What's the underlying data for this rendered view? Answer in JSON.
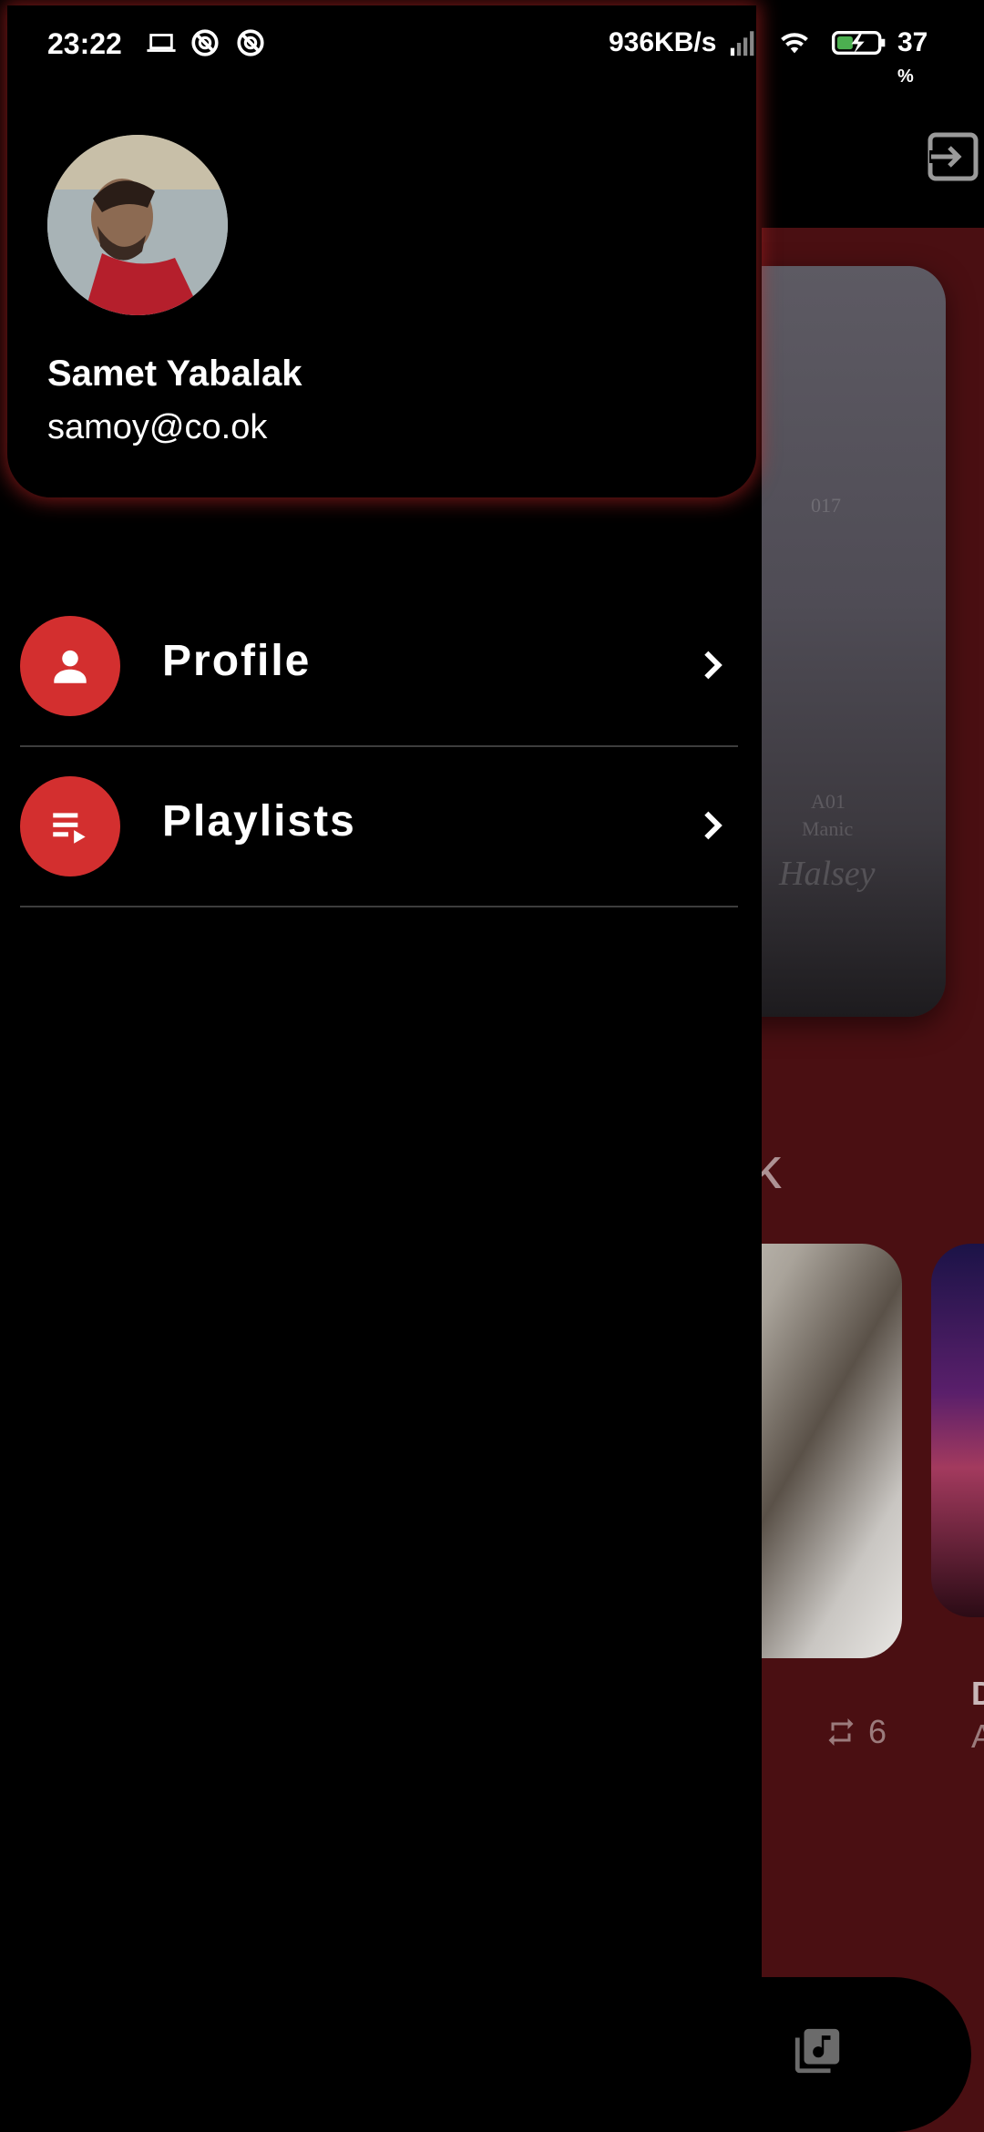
{
  "status_bar": {
    "time": "23:22",
    "net_speed": "936KB/s",
    "battery_percent": "37",
    "battery_unit": "%"
  },
  "user": {
    "name": "Samet Yabalak",
    "email": "samoy@co.ok"
  },
  "menu": [
    {
      "label": "Profile",
      "icon": "person-icon"
    },
    {
      "label": "Playlists",
      "icon": "playlist-play-icon"
    }
  ],
  "background": {
    "section_title_fragment": "ek",
    "repeat_count": "6",
    "peek_letter": "D",
    "peek_letter_2": "A",
    "album_text_1": "017",
    "album_text_2": "A01",
    "album_text_3": "Manic",
    "album_signature": "Halsey"
  },
  "colors": {
    "accent": "#d32f2f",
    "backdrop": "#4a0f12",
    "drawer": "#000000"
  }
}
